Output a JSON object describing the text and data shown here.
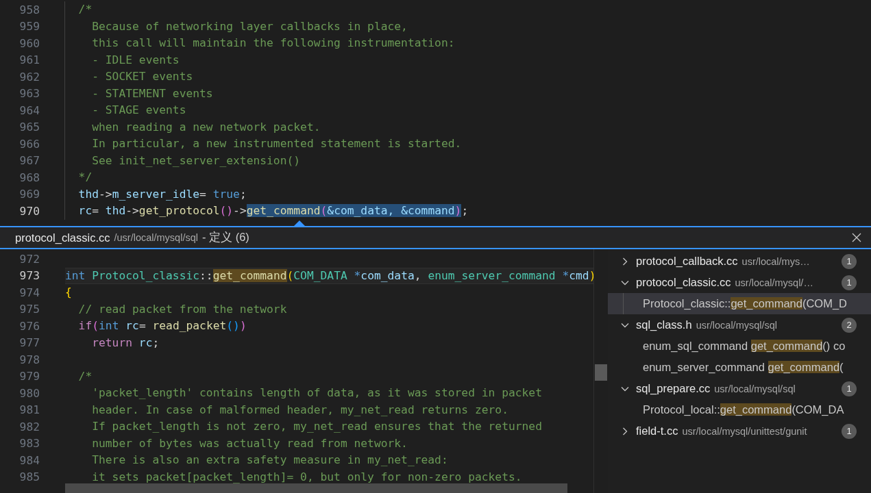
{
  "editor": {
    "lines": [
      {
        "number": "958",
        "current": false,
        "tokens": [
          {
            "kind": "comment",
            "text": "  /*"
          }
        ]
      },
      {
        "number": "959",
        "current": false,
        "tokens": [
          {
            "kind": "comment",
            "text": "    Because of networking layer callbacks in place,"
          }
        ]
      },
      {
        "number": "960",
        "current": false,
        "tokens": [
          {
            "kind": "comment",
            "text": "    this call will maintain the following instrumentation:"
          }
        ]
      },
      {
        "number": "961",
        "current": false,
        "tokens": [
          {
            "kind": "comment",
            "text": "    - IDLE events"
          }
        ]
      },
      {
        "number": "962",
        "current": false,
        "tokens": [
          {
            "kind": "comment",
            "text": "    - SOCKET events"
          }
        ]
      },
      {
        "number": "963",
        "current": false,
        "tokens": [
          {
            "kind": "comment",
            "text": "    - STATEMENT events"
          }
        ]
      },
      {
        "number": "964",
        "current": false,
        "tokens": [
          {
            "kind": "comment",
            "text": "    - STAGE events"
          }
        ]
      },
      {
        "number": "965",
        "current": false,
        "tokens": [
          {
            "kind": "comment",
            "text": "    when reading a new network packet."
          }
        ]
      },
      {
        "number": "966",
        "current": false,
        "tokens": [
          {
            "kind": "comment",
            "text": "    In particular, a new instrumented statement is started."
          }
        ]
      },
      {
        "number": "967",
        "current": false,
        "tokens": [
          {
            "kind": "comment",
            "text": "    See init_net_server_extension()"
          }
        ]
      },
      {
        "number": "968",
        "current": false,
        "tokens": [
          {
            "kind": "comment",
            "text": "  */"
          }
        ]
      },
      {
        "number": "969",
        "current": false,
        "tokens": [
          {
            "kind": "variable",
            "text": "  thd"
          },
          {
            "kind": "plain",
            "text": "->"
          },
          {
            "kind": "variable",
            "text": "m_server_idle"
          },
          {
            "kind": "plain",
            "text": "= "
          },
          {
            "kind": "keyword",
            "text": "true"
          },
          {
            "kind": "plain",
            "text": ";"
          }
        ]
      },
      {
        "number": "970",
        "current": true,
        "tokens": [
          {
            "kind": "variable",
            "text": "  rc"
          },
          {
            "kind": "plain",
            "text": "= "
          },
          {
            "kind": "variable",
            "text": "thd"
          },
          {
            "kind": "plain",
            "text": "->"
          },
          {
            "kind": "function",
            "text": "get_protocol"
          },
          {
            "kind": "bracket2",
            "text": "()"
          },
          {
            "kind": "plain",
            "text": "->"
          },
          {
            "kind": "function",
            "text": "get_command",
            "selected": true
          },
          {
            "kind": "bracket2",
            "text": "(",
            "selected": true
          },
          {
            "kind": "variable",
            "text": "&com_data, &command",
            "selected": true
          },
          {
            "kind": "bracket2",
            "text": ")",
            "selected": true
          },
          {
            "kind": "plain",
            "text": ";"
          }
        ]
      }
    ]
  },
  "peek": {
    "file": "protocol_classic.cc",
    "path": "/usr/local/mysql/sql",
    "label": "- 定义 (6)",
    "lines": [
      {
        "number": "972",
        "current": false
      },
      {
        "number": "973",
        "current": true,
        "tokens": [
          {
            "kind": "keyword",
            "text": "int "
          },
          {
            "kind": "type",
            "text": "Protocol_classic"
          },
          {
            "kind": "plain",
            "text": "::"
          },
          {
            "kind": "function",
            "text": "get_command",
            "match": true
          },
          {
            "kind": "bracket1",
            "text": "("
          },
          {
            "kind": "type",
            "text": "COM_DATA"
          },
          {
            "kind": "keyword",
            "text": " *"
          },
          {
            "kind": "variable",
            "text": "com_data"
          },
          {
            "kind": "plain",
            "text": ", "
          },
          {
            "kind": "type",
            "text": "enum_server_command"
          },
          {
            "kind": "keyword",
            "text": " *"
          },
          {
            "kind": "variable",
            "text": "cmd"
          },
          {
            "kind": "bracket1",
            "text": ")"
          }
        ]
      },
      {
        "number": "974",
        "current": false,
        "tokens": [
          {
            "kind": "bracket1",
            "text": "{"
          }
        ]
      },
      {
        "number": "975",
        "current": false,
        "tokens": [
          {
            "kind": "comment",
            "text": "  // read packet from the network"
          }
        ]
      },
      {
        "number": "976",
        "current": false,
        "tokens": [
          {
            "kind": "control",
            "text": "  if"
          },
          {
            "kind": "bracket2",
            "text": "("
          },
          {
            "kind": "keyword",
            "text": "int"
          },
          {
            "kind": "variable",
            "text": " rc"
          },
          {
            "kind": "plain",
            "text": "= "
          },
          {
            "kind": "function",
            "text": "read_packet"
          },
          {
            "kind": "bracket3",
            "text": "()"
          },
          {
            "kind": "bracket2",
            "text": ")"
          }
        ]
      },
      {
        "number": "977",
        "current": false,
        "tokens": [
          {
            "kind": "control",
            "text": "    return"
          },
          {
            "kind": "variable",
            "text": " rc"
          },
          {
            "kind": "plain",
            "text": ";"
          }
        ]
      },
      {
        "number": "978",
        "current": false
      },
      {
        "number": "979",
        "current": false,
        "tokens": [
          {
            "kind": "comment",
            "text": "  /*"
          }
        ]
      },
      {
        "number": "980",
        "current": false,
        "tokens": [
          {
            "kind": "comment",
            "text": "    'packet_length' contains length of data, as it was stored in packet"
          }
        ]
      },
      {
        "number": "981",
        "current": false,
        "tokens": [
          {
            "kind": "comment",
            "text": "    header. In case of malformed header, my_net_read returns zero."
          }
        ]
      },
      {
        "number": "982",
        "current": false,
        "tokens": [
          {
            "kind": "comment",
            "text": "    If packet_length is not zero, my_net_read ensures that the returned"
          }
        ]
      },
      {
        "number": "983",
        "current": false,
        "tokens": [
          {
            "kind": "comment",
            "text": "    number of bytes was actually read from network."
          }
        ]
      },
      {
        "number": "984",
        "current": false,
        "tokens": [
          {
            "kind": "comment",
            "text": "    There is also an extra safety measure in my_net_read:"
          }
        ]
      },
      {
        "number": "985",
        "current": false,
        "tokens": [
          {
            "kind": "comment",
            "text": "    it sets packet[packet_length]= 0, but only for non-zero packets."
          }
        ]
      }
    ],
    "results": [
      {
        "file": "protocol_callback.cc",
        "path": "usr/local/mys…",
        "count": "1",
        "expanded": false
      },
      {
        "file": "protocol_classic.cc",
        "path": "usr/local/mysql/…",
        "count": "1",
        "expanded": true,
        "references": [
          {
            "selected": true,
            "parts": [
              {
                "text": "Protocol_classic::",
                "match": false
              },
              {
                "text": "get_command",
                "match": true
              },
              {
                "text": "(COM_D",
                "match": false
              }
            ]
          }
        ]
      },
      {
        "file": "sql_class.h",
        "path": "usr/local/mysql/sql",
        "count": "2",
        "expanded": true,
        "references": [
          {
            "selected": false,
            "parts": [
              {
                "text": "enum_sql_command ",
                "match": false
              },
              {
                "text": "get_command",
                "match": true
              },
              {
                "text": "() co",
                "match": false
              }
            ]
          },
          {
            "selected": false,
            "parts": [
              {
                "text": "enum_server_command ",
                "match": false
              },
              {
                "text": "get_command",
                "match": true
              },
              {
                "text": "(",
                "match": false
              }
            ]
          }
        ]
      },
      {
        "file": "sql_prepare.cc",
        "path": "usr/local/mysql/sql",
        "count": "1",
        "expanded": true,
        "references": [
          {
            "selected": false,
            "parts": [
              {
                "text": "Protocol_local::",
                "match": false
              },
              {
                "text": "get_command",
                "match": true
              },
              {
                "text": "(COM_DA",
                "match": false
              }
            ]
          }
        ]
      },
      {
        "file": "field-t.cc",
        "path": "usr/local/mysql/unittest/gunit",
        "count": "1",
        "expanded": false
      }
    ]
  }
}
